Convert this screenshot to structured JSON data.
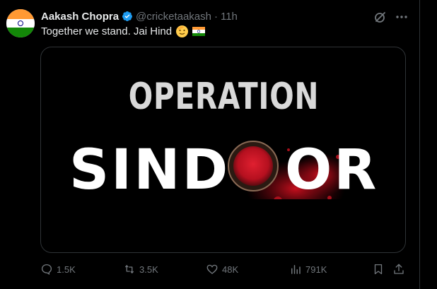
{
  "tweet": {
    "display_name": "Aakash Chopra",
    "handle": "@cricketaakash",
    "separator": "·",
    "time": "11h",
    "text": "Together we stand. Jai Hind",
    "media": {
      "headline": "OPERATION",
      "title": "SIND",
      "title_end": "OR"
    },
    "stats": {
      "replies": "1.5K",
      "reposts": "3.5K",
      "likes": "48K",
      "views": "791K"
    }
  },
  "colors": {
    "background": "#000000",
    "text_primary": "#e7e9ea",
    "text_secondary": "#71767b",
    "verified": "#1d9bf0",
    "border": "#2f3336",
    "sindoor_red": "#c8102e"
  }
}
